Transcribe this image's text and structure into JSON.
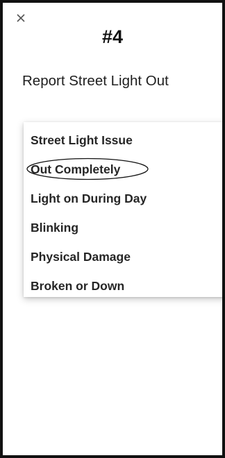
{
  "header": {
    "close_icon": "close-icon",
    "step_number": "#4"
  },
  "page": {
    "title": "Report Street Light Out"
  },
  "menu": {
    "items": [
      {
        "label": "Street Light Issue"
      },
      {
        "label": "Out Completely",
        "circled": true
      },
      {
        "label": "Light on During Day"
      },
      {
        "label": "Blinking"
      },
      {
        "label": "Physical Damage"
      },
      {
        "label": "Broken or Down"
      }
    ]
  },
  "colors": {
    "frame_border": "#111111",
    "text": "#262626",
    "background": "#ffffff"
  }
}
